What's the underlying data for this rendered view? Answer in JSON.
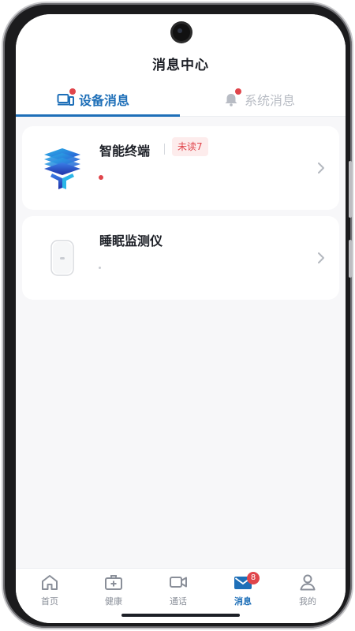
{
  "page": {
    "title": "消息中心"
  },
  "tabs": [
    {
      "label": "设备消息",
      "icon": "device-icon",
      "active": true,
      "has_dot": true
    },
    {
      "label": "系统消息",
      "icon": "bell-icon",
      "active": false,
      "has_dot": true
    }
  ],
  "devices": [
    {
      "name": "智能终端",
      "unread_badge": "未读7",
      "icon": "layered-terminal-logo",
      "has_unread_dot": true
    },
    {
      "name": "睡眠监测仪",
      "icon": "sleep-monitor-device",
      "has_unread_dot": false
    }
  ],
  "bottom_nav": [
    {
      "label": "首页",
      "icon": "home-icon",
      "active": false
    },
    {
      "label": "健康",
      "icon": "medical-kit-icon",
      "active": false
    },
    {
      "label": "通话",
      "icon": "video-camera-icon",
      "active": false
    },
    {
      "label": "消息",
      "icon": "mail-icon",
      "active": true,
      "badge": "8"
    },
    {
      "label": "我的",
      "icon": "person-icon",
      "active": false
    }
  ],
  "colors": {
    "accent": "#1e6fb8",
    "alert": "#e0454b",
    "background": "#f7f7f9"
  }
}
